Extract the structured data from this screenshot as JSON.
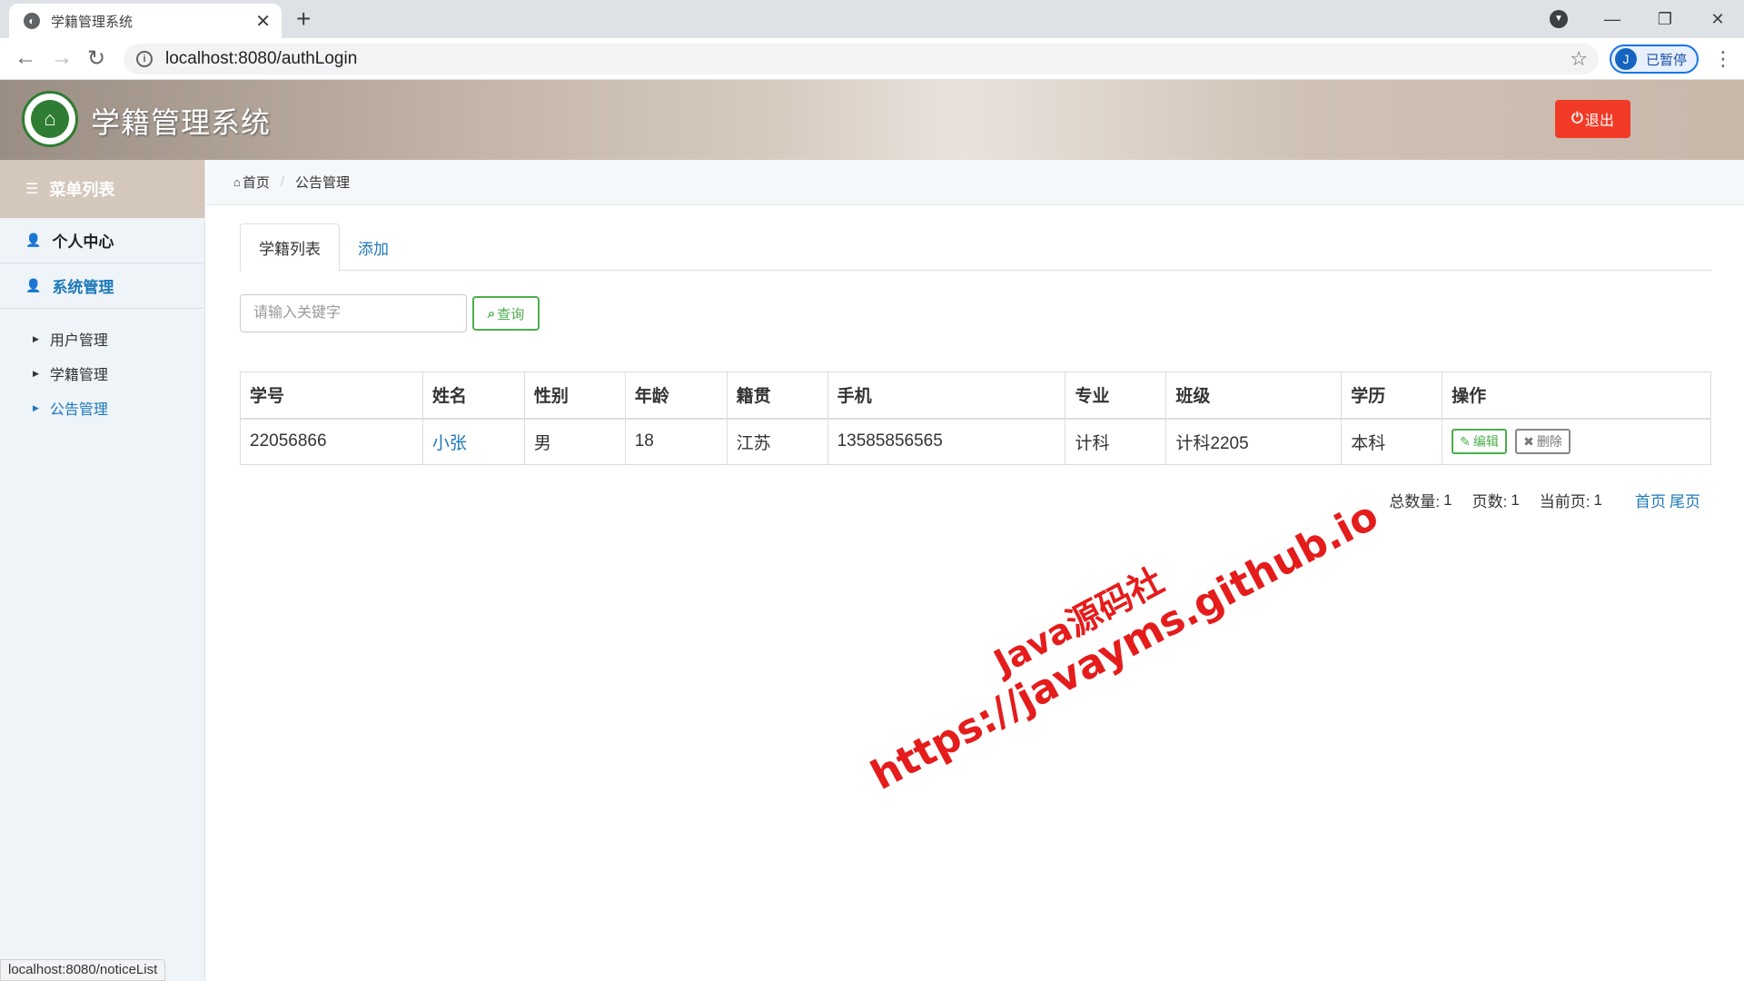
{
  "browser": {
    "tab_title": "学籍管理系统",
    "url": "localhost:8080/authLogin",
    "profile_initial": "J",
    "profile_label": "已暂停",
    "status_url": "localhost:8080/noticeList"
  },
  "header": {
    "app_title": "学籍管理系统",
    "logout_label": "退出"
  },
  "sidebar": {
    "menu_title": "菜单列表",
    "groups": [
      {
        "label": "个人中心"
      },
      {
        "label": "系统管理"
      }
    ],
    "items": [
      {
        "label": "用户管理"
      },
      {
        "label": "学籍管理"
      },
      {
        "label": "公告管理"
      }
    ]
  },
  "breadcrumb": {
    "home": "首页",
    "current": "公告管理"
  },
  "tabs": [
    {
      "label": "学籍列表"
    },
    {
      "label": "添加"
    }
  ],
  "search": {
    "placeholder": "请输入关键字",
    "button_label": "查询"
  },
  "table": {
    "headers": [
      "学号",
      "姓名",
      "性别",
      "年龄",
      "籍贯",
      "手机",
      "专业",
      "班级",
      "学历",
      "操作"
    ],
    "rows": [
      {
        "student_id": "22056866",
        "name": "小张",
        "gender": "男",
        "age": "18",
        "hometown": "江苏",
        "phone": "13585856565",
        "major": "计科",
        "class": "计科2205",
        "education": "本科",
        "edit_label": "编辑",
        "delete_label": "删除"
      }
    ]
  },
  "pagination": {
    "total_label": "总数量:",
    "total": "1",
    "pages_label": "页数:",
    "pages": "1",
    "current_label": "当前页:",
    "current": "1",
    "first_label": "首页",
    "last_label": "尾页"
  },
  "watermark": {
    "line1": "Java源码社",
    "line2": "https://javayms.github.io"
  },
  "colors": {
    "accent": "#1d79b8",
    "logout": "#f23b27",
    "success": "#4cae4c",
    "watermark": "#e51c1c"
  }
}
